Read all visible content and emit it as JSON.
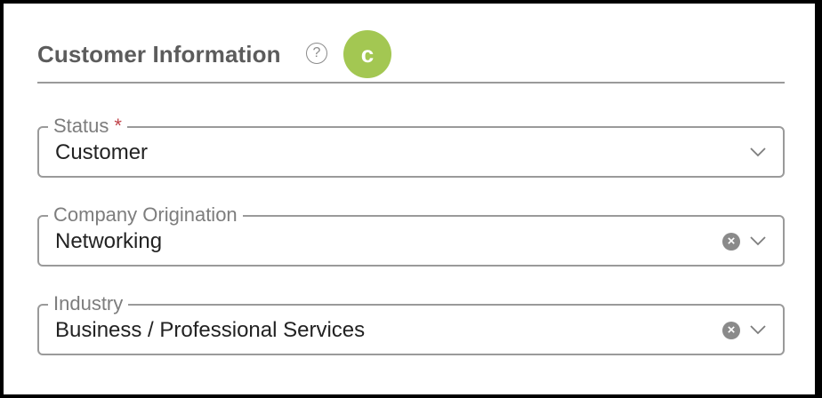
{
  "section": {
    "title": "Customer Information",
    "help_glyph": "?",
    "avatar_letter": "c",
    "avatar_color": "#a3c752"
  },
  "fields": [
    {
      "label": "Status",
      "required_mark": "*",
      "value": "Customer",
      "clearable": false
    },
    {
      "label": "Company Origination",
      "required_mark": "",
      "value": "Networking",
      "clearable": true,
      "clear_glyph": "×"
    },
    {
      "label": "Industry",
      "required_mark": "",
      "value": "Business / Professional Services",
      "clearable": true,
      "clear_glyph": "×"
    }
  ],
  "icons": {
    "help": "help-circle-icon",
    "clear": "clear-circle-icon",
    "dropdown": "chevron-down-icon"
  }
}
